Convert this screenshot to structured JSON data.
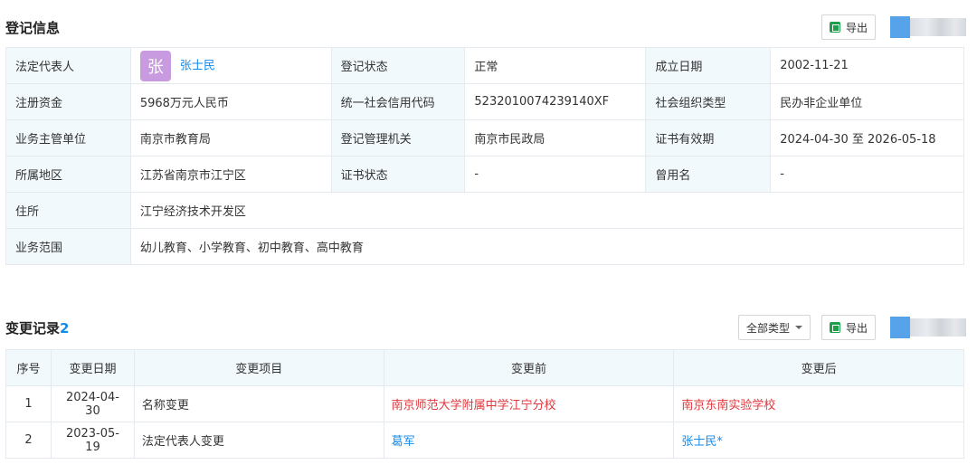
{
  "registration": {
    "title": "登记信息",
    "export_label": "导出",
    "rows": [
      [
        {
          "label": "法定代表人",
          "value": "张士民",
          "avatar": "张"
        },
        {
          "label": "登记状态",
          "value": "正常"
        },
        {
          "label": "成立日期",
          "value": "2002-11-21"
        }
      ],
      [
        {
          "label": "注册资金",
          "value": "5968万元人民币"
        },
        {
          "label": "统一社会信用代码",
          "value": "5232010074239140XF"
        },
        {
          "label": "社会组织类型",
          "value": "民办非企业单位"
        }
      ],
      [
        {
          "label": "业务主管单位",
          "value": "南京市教育局"
        },
        {
          "label": "登记管理机关",
          "value": "南京市民政局"
        },
        {
          "label": "证书有效期",
          "value": "2024-04-30 至 2026-05-18"
        }
      ],
      [
        {
          "label": "所属地区",
          "value": "江苏省南京市江宁区"
        },
        {
          "label": "证书状态",
          "value": "-"
        },
        {
          "label": "曾用名",
          "value": "-"
        }
      ]
    ],
    "address": {
      "label": "住所",
      "value": "江宁经济技术开发区"
    },
    "scope": {
      "label": "业务范围",
      "value": "幼儿教育、小学教育、初中教育、高中教育"
    }
  },
  "changes": {
    "title": "变更记录",
    "count": "2",
    "filter_label": "全部类型",
    "export_label": "导出",
    "headers": [
      "序号",
      "变更日期",
      "变更项目",
      "变更前",
      "变更后"
    ],
    "rows": [
      {
        "index": "1",
        "date": "2024-04-30",
        "item": "名称变更",
        "before": "南京师范大学附属中学江宁分校",
        "after": "南京东南实验学校"
      },
      {
        "index": "2",
        "date": "2023-05-19",
        "item": "法定代表人变更",
        "before": "葛军",
        "after": "张士民*"
      }
    ]
  },
  "colors": {
    "accent": "#128bed",
    "label_bg": "#f2f9fc",
    "red": "#e0373c"
  }
}
